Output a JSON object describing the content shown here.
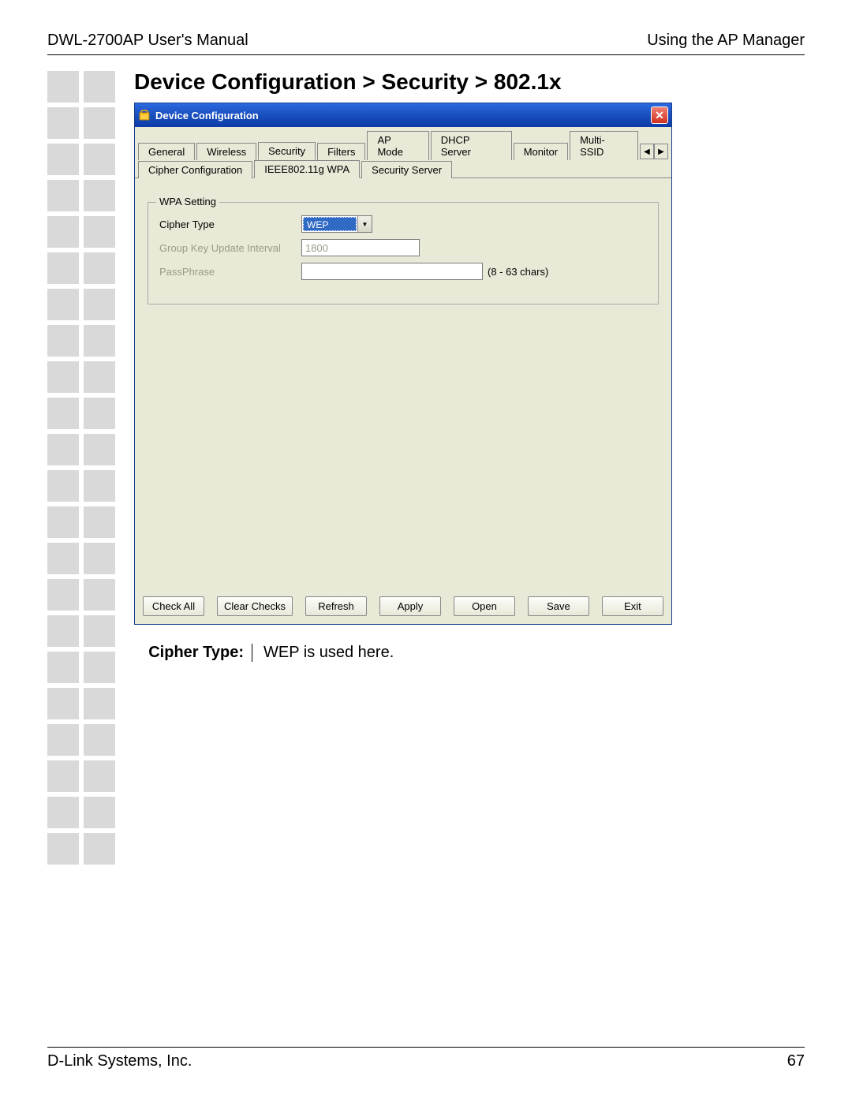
{
  "header": {
    "left": "DWL-2700AP User's Manual",
    "right": "Using the AP Manager"
  },
  "section_title": "Device Configuration > Security > 802.1x",
  "window": {
    "title": "Device Configuration",
    "close_label": "✕",
    "tabs_row1": [
      "General",
      "Wireless",
      "Security",
      "Filters",
      "AP Mode",
      "DHCP Server",
      "Monitor",
      "Multi-SSID"
    ],
    "tabs_row1_active": "Security",
    "tab_scroll_left": "◀",
    "tab_scroll_right": "▶",
    "tabs_row2": [
      "Cipher Configuration",
      "IEEE802.11g WPA",
      "Security Server"
    ],
    "tabs_row2_active": "IEEE802.11g WPA",
    "fieldset_legend": "WPA Setting",
    "fields": {
      "cipher_type_label": "Cipher Type",
      "cipher_type_value": "WEP",
      "group_key_label": "Group Key Update Interval",
      "group_key_value": "1800",
      "passphrase_label": "PassPhrase",
      "passphrase_value": "",
      "passphrase_hint": "(8 - 63 chars)"
    },
    "buttons": [
      "Check All",
      "Clear Checks",
      "Refresh",
      "Apply",
      "Open",
      "Save",
      "Exit"
    ]
  },
  "description": {
    "label": "Cipher Type:",
    "text": "WEP is used here."
  },
  "footer": {
    "left": "D-Link Systems, Inc.",
    "right": "67"
  }
}
